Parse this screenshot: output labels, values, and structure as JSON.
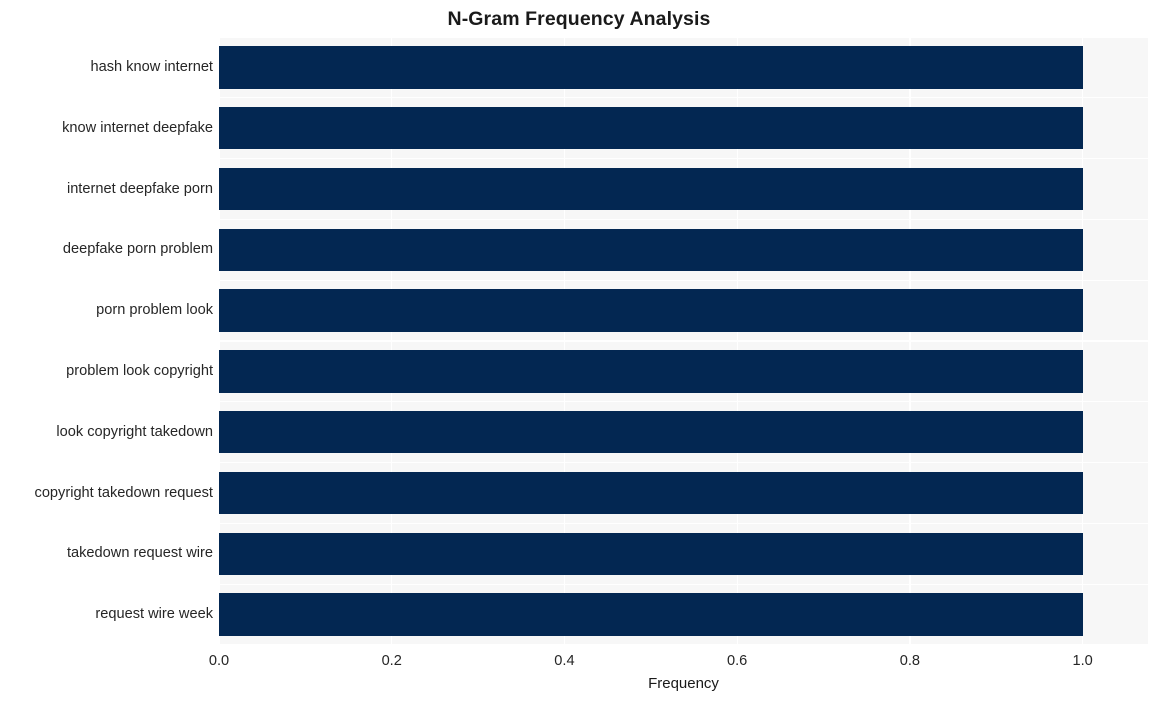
{
  "chart_data": {
    "type": "bar",
    "orientation": "horizontal",
    "title": "N-Gram Frequency Analysis",
    "xlabel": "Frequency",
    "ylabel": "",
    "categories": [
      "hash know internet",
      "know internet deepfake",
      "internet deepfake porn",
      "deepfake porn problem",
      "porn problem look",
      "problem look copyright",
      "look copyright takedown",
      "copyright takedown request",
      "takedown request wire",
      "request wire week"
    ],
    "values": [
      1.0,
      1.0,
      1.0,
      1.0,
      1.0,
      1.0,
      1.0,
      1.0,
      1.0,
      1.0
    ],
    "xlim": [
      0.0,
      1.0757
    ],
    "xticks": [
      0.0,
      0.2,
      0.4,
      0.6,
      0.8,
      1.0
    ],
    "xtick_labels": [
      "0.0",
      "0.2",
      "0.4",
      "0.6",
      "0.8",
      "1.0"
    ],
    "bar_color": "#032752",
    "plot_background": "#f7f7f7",
    "grid": true,
    "grid_color": "#ffffff",
    "legend": false
  }
}
